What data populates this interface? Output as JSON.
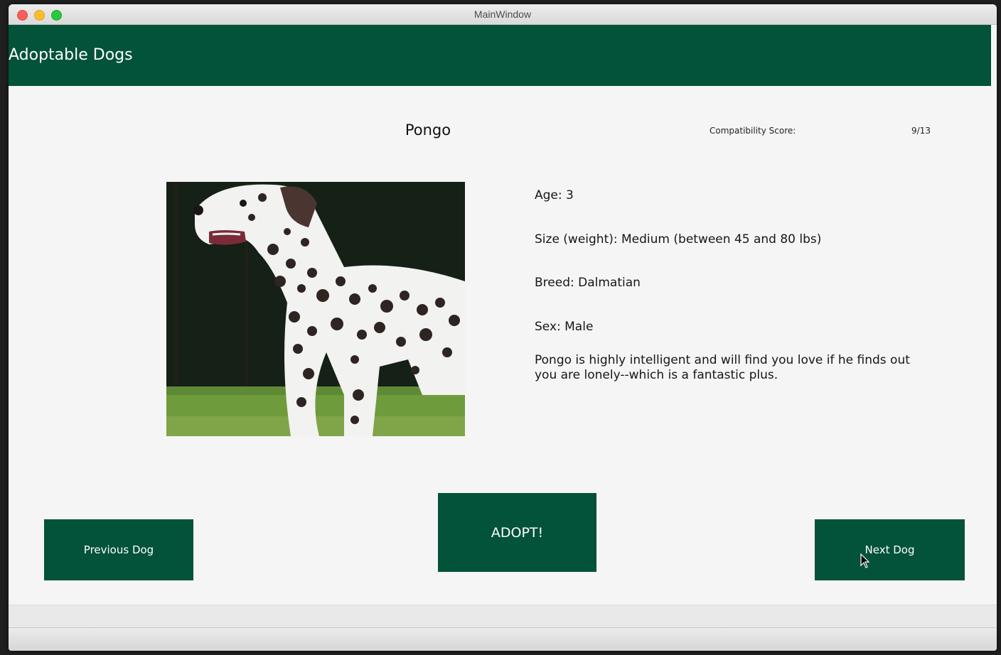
{
  "window": {
    "title": "MainWindow"
  },
  "header": {
    "title": "Adoptable Dogs"
  },
  "dog": {
    "name": "Pongo",
    "compatibility_label": "Compatibility Score:",
    "compatibility_value": "9/13",
    "age": "Age: 3",
    "size": "Size (weight): Medium (between 45 and 80 lbs)",
    "breed": "Breed: Dalmatian",
    "sex": "Sex: Male",
    "description": "Pongo is highly intelligent and will find you love if he finds out you are lonely--which is a fantastic plus.",
    "photo_icon": "dalmatian-photo"
  },
  "buttons": {
    "previous": "Previous Dog",
    "adopt": "ADOPT!",
    "next": "Next Dog"
  },
  "colors": {
    "brand_green": "#03523a",
    "background": "#f5f5f5"
  }
}
